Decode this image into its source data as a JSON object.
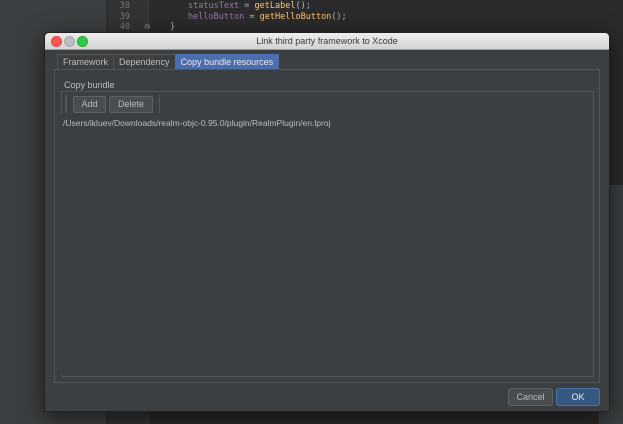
{
  "editor": {
    "lines": [
      {
        "num": "38",
        "var": "statusText",
        "op": " = ",
        "fn": "getLabel",
        "tail": "();"
      },
      {
        "num": "39",
        "var": "helloButton",
        "op": " = ",
        "fn": "getHelloButton",
        "tail": "();"
      },
      {
        "num": "40",
        "brace": "}"
      }
    ]
  },
  "dialog": {
    "title": "Link third party framework to Xcode",
    "tabs": [
      {
        "label": "Framework",
        "active": false
      },
      {
        "label": "Dependency",
        "active": false
      },
      {
        "label": "Copy bundle resources",
        "active": true
      }
    ],
    "group_label": "Copy bundle",
    "toolbar": {
      "add_label": "Add",
      "delete_label": "Delete"
    },
    "items": [
      "/Users/ikluev/Downloads/realm-objc-0.95.0/plugin/RealmPlugin/en.lproj"
    ],
    "footer": {
      "cancel_label": "Cancel",
      "ok_label": "OK"
    }
  },
  "colors": {
    "accent": "#4b6eaf",
    "ok_button": "#365880",
    "close": "#fc5753",
    "maximize": "#34c84a"
  }
}
